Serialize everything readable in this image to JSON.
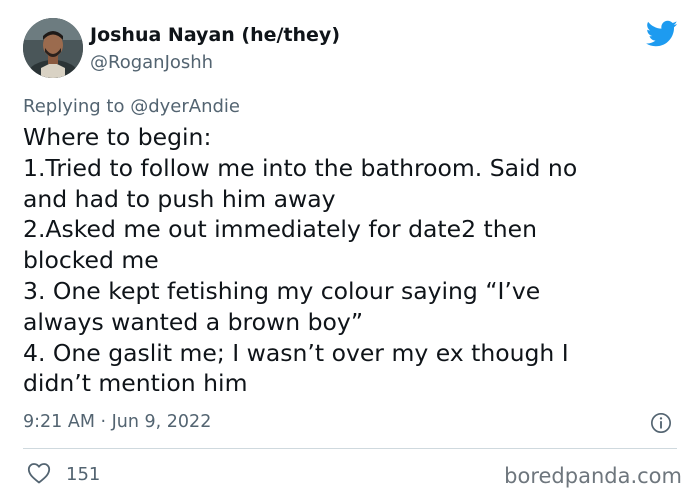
{
  "tweet": {
    "author_name": "Joshua Nayan (he/they)",
    "author_handle": "@RoganJoshh",
    "replying_prefix": "Replying to ",
    "replying_handle": "@dyerAndie",
    "body_lines": [
      "Where to begin:",
      "1.Tried to follow me into the bathroom. Said no",
      "and had to push him away",
      "2.Asked me out immediately for date2 then",
      "blocked me",
      "3. One kept fetishing my colour saying “I’ve",
      "always wanted a brown boy”",
      "4. One gaslit me; I wasn’t over my ex though I",
      "didn’t mention him"
    ],
    "timestamp": "9:21 AM · Jun 9, 2022",
    "like_count": "151"
  },
  "watermark": "boredpanda.com",
  "icons": {
    "brand": "twitter-bird-icon",
    "info": "info-icon",
    "like": "heart-icon"
  },
  "colors": {
    "twitter_blue": "#1d9bf0",
    "text_primary": "#0f1419",
    "text_secondary": "#536471"
  }
}
